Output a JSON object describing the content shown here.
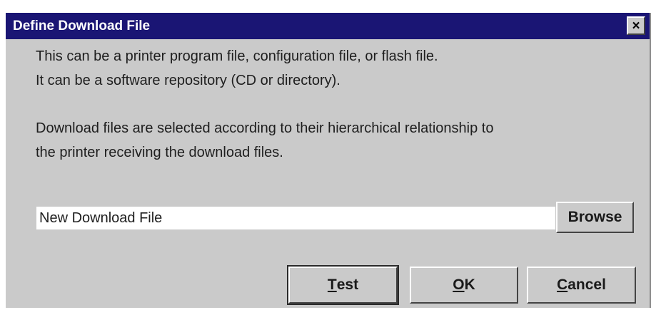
{
  "dialog": {
    "title": "Define Download File",
    "close_symbol": "×",
    "close_icon": "close-icon"
  },
  "message": {
    "line1": "This can be a printer program file, configuration file, or flash file.",
    "line2": "It can be a software repository (CD or directory).",
    "line3": "Download files are selected according to their hierarchical relationship to",
    "line4": "the printer receiving the download files."
  },
  "file_field": {
    "value": "New Download File"
  },
  "buttons": {
    "browse": "Browse",
    "test_mnemonic": "T",
    "test_rest": "est",
    "ok_mnemonic": "O",
    "ok_rest": "K",
    "cancel_mnemonic": "C",
    "cancel_rest": "ancel"
  }
}
